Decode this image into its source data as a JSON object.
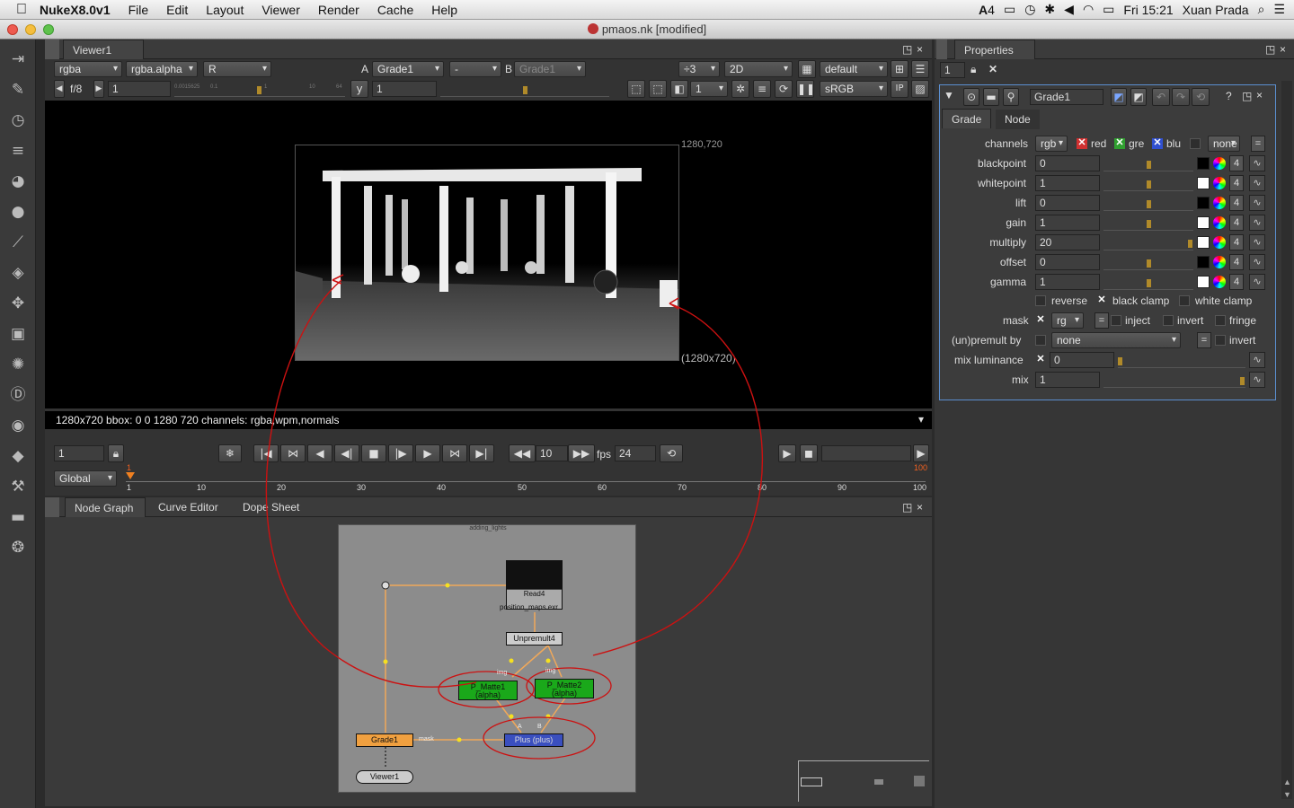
{
  "menubar": {
    "app": "NukeX8.0v1",
    "items": [
      "File",
      "Edit",
      "Layout",
      "Viewer",
      "Render",
      "Cache",
      "Help"
    ],
    "status_icons": [
      "adobe-icon",
      "battery-icon",
      "time-machine-icon",
      "bluetooth-icon",
      "volume-icon",
      "wifi-icon",
      "battery-icon",
      "search-icon",
      "list-icon"
    ],
    "adobe_count": "4",
    "clock": "Fri 15:21",
    "user": "Xuan Prada"
  },
  "window": {
    "title": "pmaos.nk [modified]"
  },
  "viewer": {
    "tab": "Viewer1",
    "channels": "rgba",
    "alpha_channel": "rgba.alpha",
    "display_channel": "R",
    "a_label": "A",
    "a_input": "Grade1",
    "compare_mode": "-",
    "b_label": "B",
    "b_input": "Grade1",
    "downscale": "÷3",
    "view_mode": "2D",
    "lut": "default",
    "fstop": "f/8",
    "gain_value": "1",
    "gamma_label": "y",
    "gamma_value": "1",
    "proxy_value": "1",
    "colorspace": "sRGB",
    "ip_label": "IP",
    "format_top_right": "1280,720",
    "format_bottom_right": "(1280x720)",
    "status": "1280x720 bbox: 0 0 1280 720 channels: rgba,wpm,normals",
    "slider_ticks": [
      "0.0015625",
      "0.1",
      "1",
      "10",
      "64"
    ]
  },
  "timeline": {
    "frame": "1",
    "step": "10",
    "fps_label": "fps",
    "fps": "24",
    "range_mode": "Global",
    "start_marker": "1",
    "end_marker": "100",
    "ticks": [
      "1",
      "10",
      "20",
      "30",
      "40",
      "50",
      "60",
      "70",
      "80",
      "90",
      "100"
    ]
  },
  "bottom_tabs": [
    "Node Graph",
    "Curve Editor",
    "Dope Sheet"
  ],
  "node_graph": {
    "backdrop_label": "adding_lights",
    "nodes": {
      "read": "Read4",
      "read_file": "position_maps.exr",
      "unpremult": "Unpremult4",
      "pmatte1": "P_Matte1",
      "pmatte1_sub": "(alpha)",
      "pmatte2": "P_Matte2",
      "pmatte2_sub": "(alpha)",
      "plus": "Plus (plus)",
      "grade": "Grade1",
      "viewer": "Viewer1"
    },
    "edge_labels": {
      "pmatte1_in": "img",
      "pmatte2_in": "img",
      "mask": "mask",
      "plus_a": "A",
      "plus_b": "B"
    }
  },
  "properties": {
    "title": "Properties",
    "max_panels": "1",
    "node_name": "Grade1",
    "tabs": [
      "Grade",
      "Node"
    ],
    "channels_label": "channels",
    "channels_value": "rgb",
    "channel_checks": [
      "red",
      "green",
      "blue"
    ],
    "channel_short": [
      "red",
      "gre",
      "blu"
    ],
    "channel_extra": "none",
    "params": [
      {
        "label": "blackpoint",
        "value": "0",
        "swatch": "#000000"
      },
      {
        "label": "whitepoint",
        "value": "1",
        "swatch": "#ffffff"
      },
      {
        "label": "lift",
        "value": "0",
        "swatch": "#000000"
      },
      {
        "label": "gain",
        "value": "1",
        "swatch": "#ffffff"
      },
      {
        "label": "multiply",
        "value": "20",
        "swatch": "#ffffff"
      },
      {
        "label": "offset",
        "value": "0",
        "swatch": "#000000"
      },
      {
        "label": "gamma",
        "value": "1",
        "swatch": "#ffffff"
      }
    ],
    "reverse_label": "reverse",
    "black_clamp_label": "black clamp",
    "white_clamp_label": "white clamp",
    "mask_label": "mask",
    "mask_channel": "rgba.alpha",
    "mask_channel_short": "rg",
    "inject_label": "inject",
    "invert_label": "invert",
    "fringe_label": "fringe",
    "unpremult_label": "(un)premult by",
    "unpremult_value": "none",
    "invert2_label": "invert",
    "mix_luminance_label": "mix luminance",
    "mix_luminance_value": "0",
    "mix_label": "mix",
    "mix_value": "1",
    "channel_count": "4"
  },
  "colors": {
    "pmatte": "#1aa81a",
    "plus": "#3a4fbf",
    "grade": "#f0a040",
    "annotation": "#cc1111"
  }
}
